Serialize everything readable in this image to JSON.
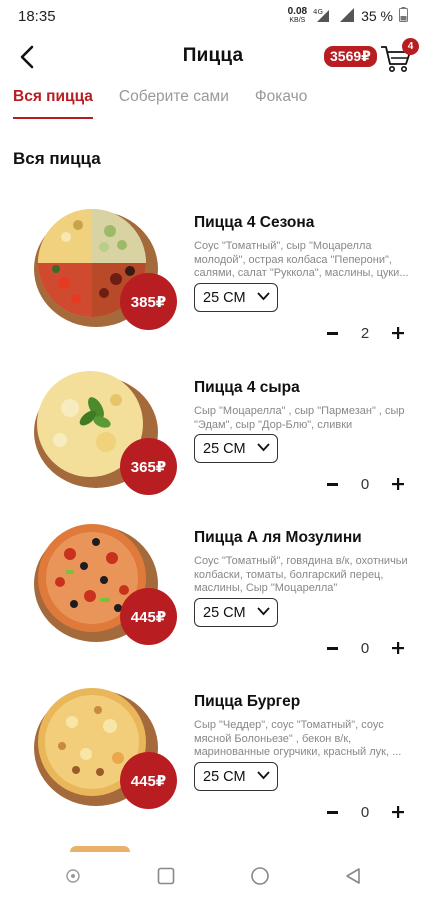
{
  "status": {
    "time": "18:35",
    "net_speed": "0.08",
    "net_unit": "KB/S",
    "network": "4G",
    "battery": "35 %"
  },
  "header": {
    "title": "Пицца",
    "cart_total": "3569₽",
    "cart_count": "4"
  },
  "tabs": [
    {
      "label": "Вся пицца",
      "active": true
    },
    {
      "label": "Соберите сами",
      "active": false
    },
    {
      "label": "Фокачо",
      "active": false
    }
  ],
  "section_title": "Вся пицца",
  "products": [
    {
      "name": "Пицца 4 Сезона",
      "description": "Соус \"Томатный\", сыр \"Моцарелла молодой\", острая колбаса \"Пеперони\", салями, салат \"Руккола\", маслины, цуки...",
      "price": "385₽",
      "size": "25 СМ",
      "qty": "2"
    },
    {
      "name": "Пицца 4 сыра",
      "description": "Сыр \"Моцарелла\" , сыр \"Пармезан\" , сыр \"Эдам\", сыр \"Дор-Блю\", сливки",
      "price": "365₽",
      "size": "25 СМ",
      "qty": "0"
    },
    {
      "name": "Пицца А ля Мозулини",
      "description": "Соус \"Томатный\", говядина в/к, охотничьи колбаски, томаты, болгарский перец, маслины, Сыр \"Моцарелла\"",
      "price": "445₽",
      "size": "25 СМ",
      "qty": "0"
    },
    {
      "name": "Пицца Бургер",
      "description": "Сыр \"Чеддер\", соус \"Томатный\", соус мясной Болоньезе\" , бекон в/к, маринованные огурчики, красный лук, ...",
      "price": "445₽",
      "size": "25 СМ",
      "qty": "0"
    }
  ],
  "colors": {
    "accent": "#b81d22",
    "muted_text": "#888888"
  },
  "icons": {
    "back": "arrow-left-icon",
    "cart": "shopping-cart-icon",
    "minus": "minus-icon",
    "plus": "plus-icon",
    "dropdown": "chevron-down-icon"
  }
}
